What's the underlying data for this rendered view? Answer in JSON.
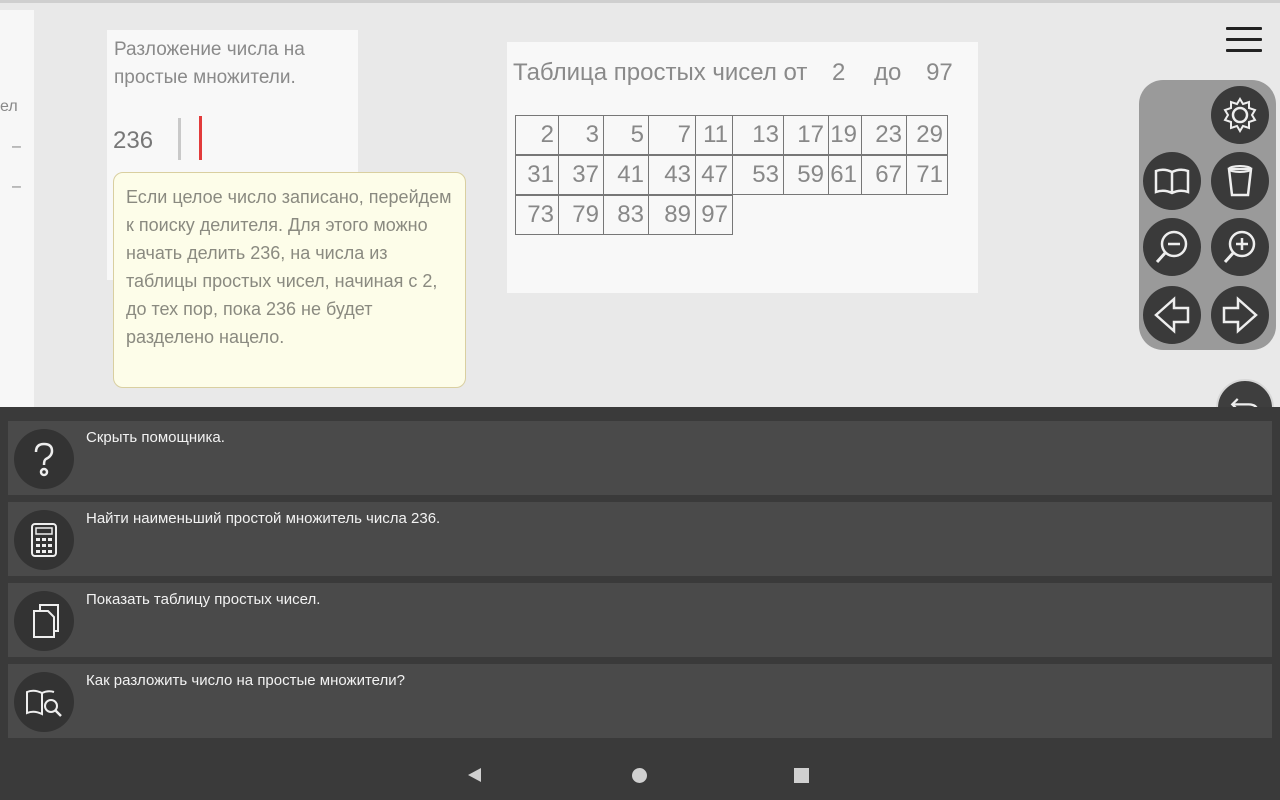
{
  "left_panel": {
    "fragments": [
      "ел",
      "–",
      "–"
    ]
  },
  "factorization": {
    "title": "Разложение числа на простые множители.",
    "number": "236"
  },
  "tooltip": {
    "text": "Если целое число записано, перейдем к поиску делителя. Для этого можно начать делить 236, на числа из таблицы простых чисел, начиная с 2, до тех пор, пока 236 не будет разделено нацело."
  },
  "primes_table": {
    "title_prefix": "Таблица простых чисел от",
    "from": "2",
    "to_word": "до",
    "to": "97",
    "rows": [
      [
        "2",
        "3",
        "5",
        "7",
        "11",
        "13",
        "17",
        "19",
        "23",
        "29"
      ],
      [
        "31",
        "37",
        "41",
        "43",
        "47",
        "53",
        "59",
        "61",
        "67",
        "71"
      ],
      [
        "73",
        "79",
        "83",
        "89",
        "97"
      ]
    ]
  },
  "tools": {
    "icons": [
      "gear-icon",
      "book-icon",
      "trash-icon",
      "zoom-out-icon",
      "zoom-in-icon",
      "arrow-left-icon",
      "arrow-right-icon",
      "undo-icon"
    ]
  },
  "assistant": {
    "items": [
      {
        "icon": "question-icon",
        "label": "Скрыть помощника."
      },
      {
        "icon": "calculator-icon",
        "label": "Найти наименьший простой множитель числа 236."
      },
      {
        "icon": "document-icon",
        "label": "Показать таблицу простых чисел."
      },
      {
        "icon": "book-search-icon",
        "label": "Как разложить число на простые множители?"
      }
    ]
  },
  "colors": {
    "cursor": "#e23b3b",
    "tooltip_bg": "#fdfde9",
    "panel_dark": "#3a3a3a"
  }
}
